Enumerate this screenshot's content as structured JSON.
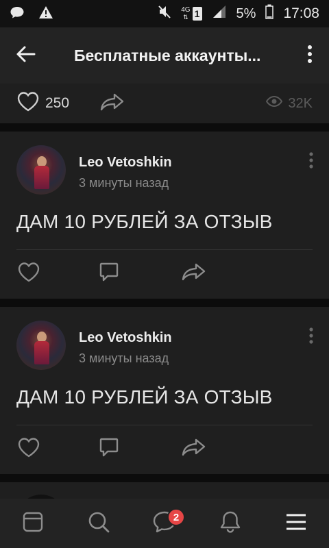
{
  "status_bar": {
    "network_label": "4G",
    "sim_label": "1",
    "battery_percent": "5%",
    "time": "17:08",
    "icons": [
      "message-icon",
      "alert-icon",
      "mute-icon",
      "signal-icon",
      "battery-icon"
    ]
  },
  "app_bar": {
    "title": "Бесплатные аккаунты...",
    "back_icon": "arrow-left-icon",
    "more_icon": "more-vertical-icon"
  },
  "top_card": {
    "likes": "250",
    "views": "32K"
  },
  "posts": [
    {
      "author": "Leo Vetoshkin",
      "time": "3 минуты назад",
      "text": "ДАМ 10 РУБЛЕЙ ЗА ОТЗЫВ"
    },
    {
      "author": "Leo Vetoshkin",
      "time": "3 минуты назад",
      "text": "ДАМ 10 РУБЛЕЙ ЗА ОТЗЫВ"
    }
  ],
  "tab_bar": {
    "messages_badge": "2",
    "tabs": [
      "news-icon",
      "search-icon",
      "messages-icon",
      "notifications-icon",
      "menu-icon"
    ]
  },
  "colors": {
    "background": "#0c0c0c",
    "card": "#1f1f1f",
    "bar": "#232323",
    "badge": "#e64646"
  }
}
